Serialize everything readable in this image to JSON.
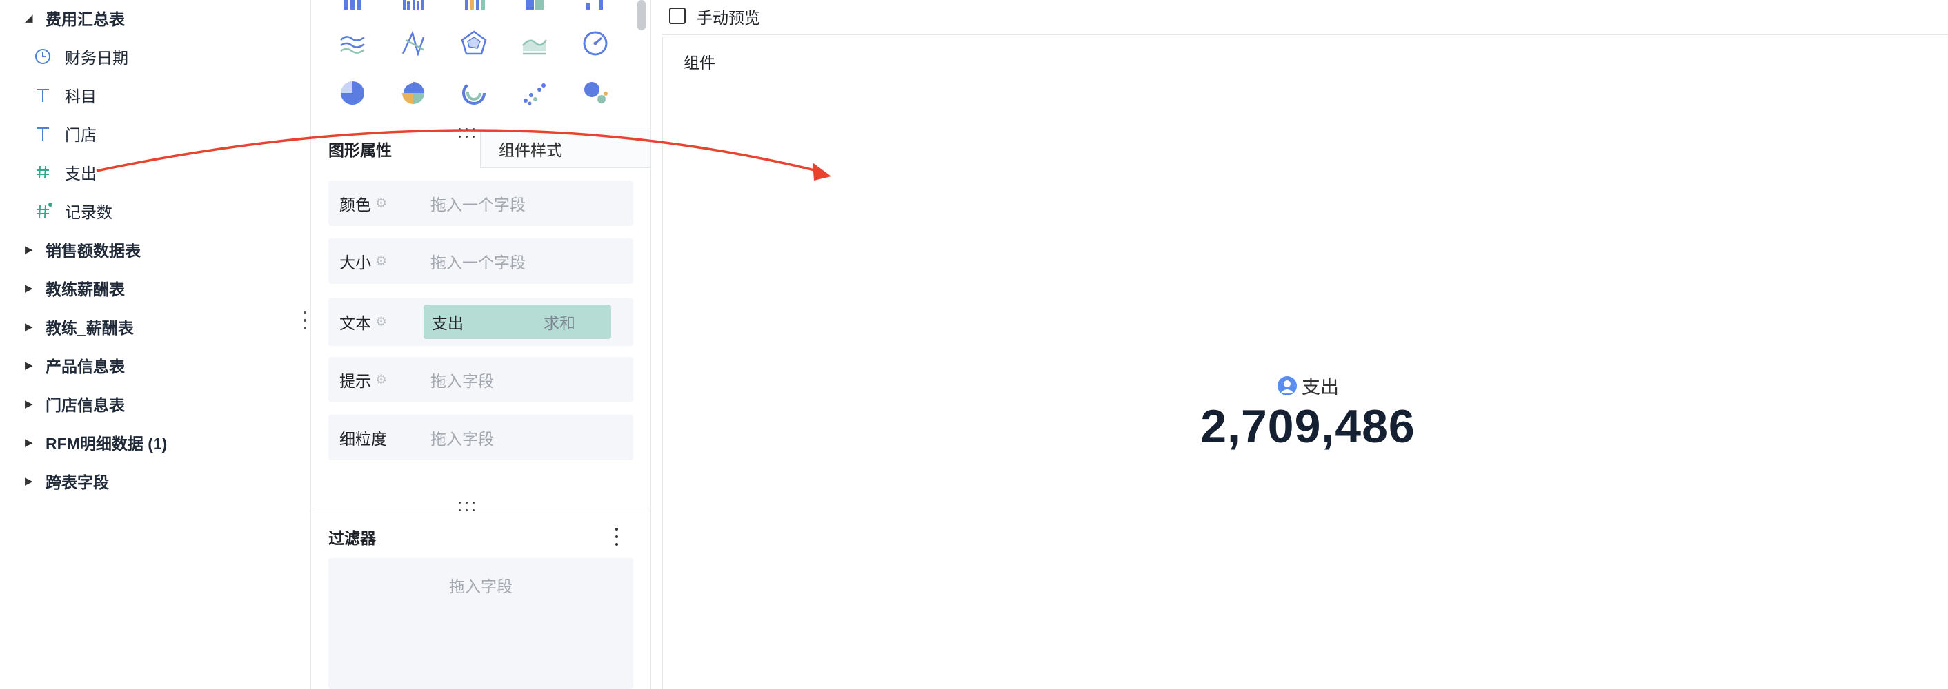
{
  "field_tree": {
    "expanded_group": "费用汇总表",
    "fields": [
      {
        "type": "date",
        "label": "财务日期",
        "icon": "clock-icon"
      },
      {
        "type": "text",
        "label": "科目",
        "icon": "text-t-icon"
      },
      {
        "type": "text",
        "label": "门店",
        "icon": "text-t-icon"
      },
      {
        "type": "number",
        "label": "支出",
        "icon": "hash-icon"
      },
      {
        "type": "calculated-number",
        "label": "记录数",
        "icon": "hash-plus-icon"
      }
    ],
    "collapsed_groups": [
      "销售额数据表",
      "教练薪酬表",
      "教练_薪酬表",
      "产品信息表",
      "门店信息表",
      "RFM明细数据 (1)",
      "跨表字段"
    ]
  },
  "chart_types": [
    "multi-line-icon",
    "radar-line-icon",
    "radar-icon",
    "area-icon",
    "gauge-icon",
    "pie-icon",
    "rose-pie-icon",
    "ring-icon",
    "scatter-icon",
    "bubble-icon"
  ],
  "tabs": {
    "active": "图形属性",
    "inactive": "组件样式"
  },
  "properties": [
    {
      "label": "颜色",
      "has_gear": true,
      "placeholder": "拖入一个字段"
    },
    {
      "label": "大小",
      "has_gear": true,
      "placeholder": "拖入一个字段"
    },
    {
      "label": "文本",
      "has_gear": true,
      "field": "支出",
      "aggregation": "求和"
    },
    {
      "label": "提示",
      "has_gear": true,
      "placeholder": "拖入字段"
    },
    {
      "label": "细粒度",
      "has_gear": false,
      "placeholder": "拖入字段"
    }
  ],
  "filter": {
    "title": "过滤器",
    "placeholder": "拖入字段"
  },
  "preview": {
    "manual_preview_label": "手动预览",
    "manual_preview_checked": false,
    "widget_label": "组件",
    "kpi_caption": "支出",
    "kpi_value": "2,709,486"
  },
  "colors": {
    "accent_blue": "#4a7fd6",
    "field_green": "#3aa58a",
    "pill_bg": "#b6dcd6",
    "annotation_arrow": "#e8432e",
    "kpi_text": "#162033"
  }
}
